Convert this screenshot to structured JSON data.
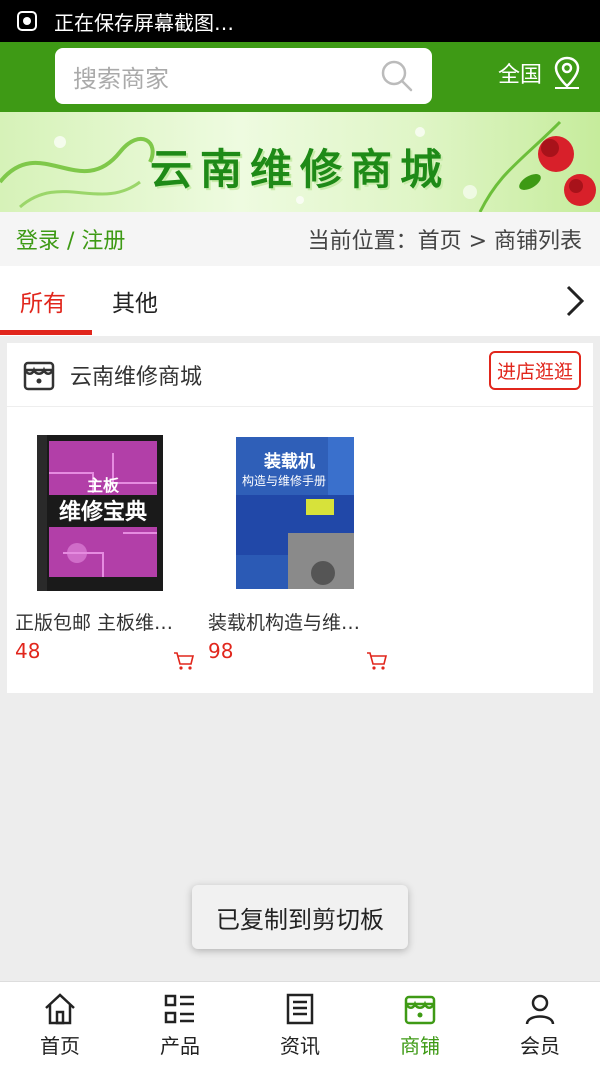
{
  "status_bar": {
    "text": "正在保存屏幕截图…"
  },
  "header": {
    "search_placeholder": "搜索商家",
    "region": "全国"
  },
  "banner": {
    "title": "云南维修商城"
  },
  "crumb_bar": {
    "login": "登录 / 注册",
    "breadcrumb": "当前位置：首页 > 商铺列表"
  },
  "tabs": [
    {
      "label": "所有",
      "active": true
    },
    {
      "label": "其他",
      "active": false
    }
  ],
  "shop": {
    "name": "云南维修商城",
    "enter_label": "进店逛逛",
    "products": [
      {
        "name": "正版包邮 主板维…",
        "price": "48",
        "cover_title": "主板",
        "cover_subtitle": "维修宝典"
      },
      {
        "name": "装载机构造与维…",
        "price": "98",
        "cover_title": "装载机",
        "cover_subtitle": "构造与维修手册"
      }
    ]
  },
  "toast": {
    "text": "已复制到剪切板"
  },
  "bottom_nav": [
    {
      "label": "首页",
      "icon": "home-icon",
      "active": false
    },
    {
      "label": "产品",
      "icon": "list-icon",
      "active": false
    },
    {
      "label": "资讯",
      "icon": "news-icon",
      "active": false
    },
    {
      "label": "商铺",
      "icon": "store-icon",
      "active": true
    },
    {
      "label": "会员",
      "icon": "user-icon",
      "active": false
    }
  ],
  "colors": {
    "brand_green": "#3e9a15",
    "accent_red": "#e1261c"
  }
}
